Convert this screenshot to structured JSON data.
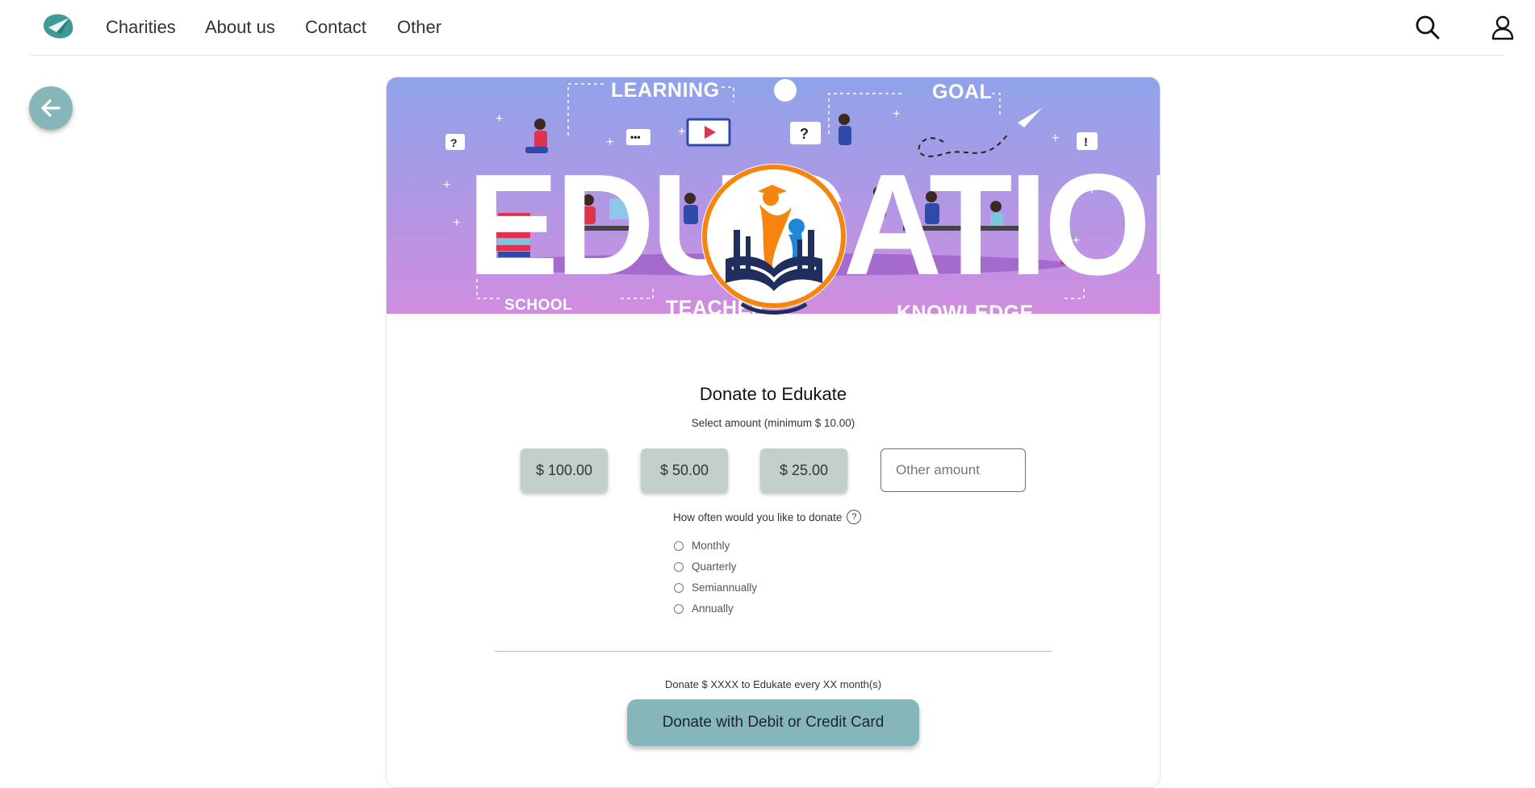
{
  "nav": {
    "links": [
      "Charities",
      "About us",
      "Contact",
      "Other"
    ],
    "icons": {
      "logo": "leaf-bird-logo",
      "search": "search-icon",
      "user": "user-icon"
    }
  },
  "back": {
    "icon": "arrow-left-icon"
  },
  "banner": {
    "words": [
      "LEARNING",
      "GOAL",
      "SCHOOL",
      "TEACHER",
      "KNOWLEDGE",
      "EDUCATION"
    ]
  },
  "donation": {
    "title": "Donate to Edukate",
    "subtitle": "Select amount (minimum $ 10.00)",
    "amounts": [
      "$ 100.00",
      "$ 50.00",
      "$ 25.00"
    ],
    "other_placeholder": "Other amount",
    "frequency_question": "How often would you like to donate",
    "help_glyph": "?",
    "frequencies": [
      "Monthly",
      "Quarterly",
      "Semiannually",
      "Annually"
    ],
    "summary": "Donate $ XXXX to Edukate every XX month(s)",
    "cta": "Donate with Debit or Credit Card"
  },
  "colors": {
    "accent": "#85b6ba",
    "amount_bg": "#c3d0c9",
    "banner_top": "#8fa3ea",
    "banner_bottom": "#d08de0"
  }
}
